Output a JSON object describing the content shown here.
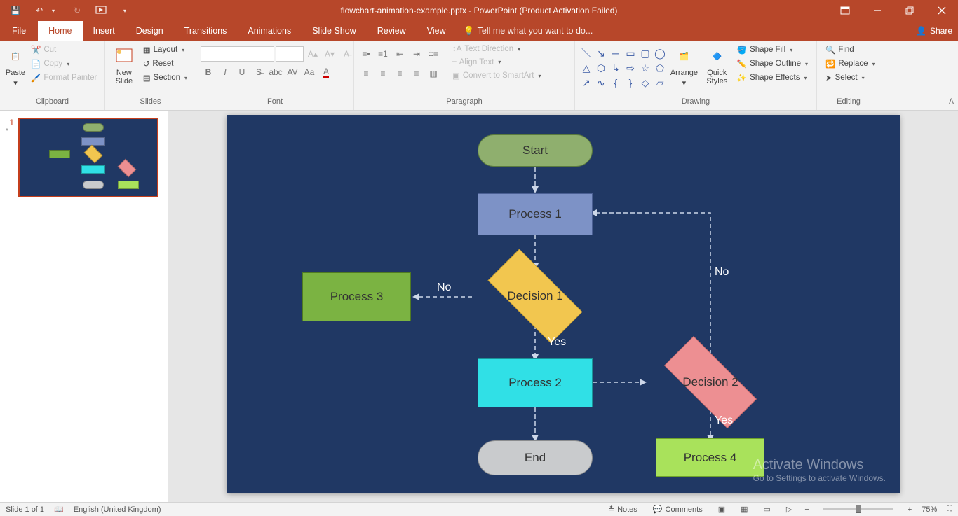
{
  "app": {
    "title": "flowchart-animation-example.pptx - PowerPoint (Product Activation Failed)"
  },
  "qat": {
    "save": "save",
    "undo": "undo",
    "redo": "redo",
    "startfrombeg": "start-from-beginning"
  },
  "wincontrols": {
    "ribbonopts": "ribbon-display-options",
    "min": "minimize",
    "max": "restore",
    "close": "close"
  },
  "tabs": {
    "file": "File",
    "home": "Home",
    "insert": "Insert",
    "design": "Design",
    "transitions": "Transitions",
    "animations": "Animations",
    "slideshow": "Slide Show",
    "review": "Review",
    "view": "View",
    "tellme": "Tell me what you want to do...",
    "share": "Share"
  },
  "ribbon": {
    "clipboard": {
      "paste": "Paste",
      "cut": "Cut",
      "copy": "Copy",
      "formatpainter": "Format Painter",
      "label": "Clipboard"
    },
    "slides": {
      "newslide": "New\nSlide",
      "layout": "Layout",
      "reset": "Reset",
      "section": "Section",
      "label": "Slides"
    },
    "font": {
      "label": "Font"
    },
    "paragraph": {
      "textdir": "Text Direction",
      "align": "Align Text",
      "smartart": "Convert to SmartArt",
      "label": "Paragraph"
    },
    "drawing": {
      "arrange": "Arrange",
      "quickstyles": "Quick\nStyles",
      "shapefill": "Shape Fill",
      "shapeoutline": "Shape Outline",
      "shapeeffects": "Shape Effects",
      "label": "Drawing"
    },
    "editing": {
      "find": "Find",
      "replace": "Replace",
      "select": "Select",
      "label": "Editing"
    }
  },
  "thumbs": {
    "slidenum": "1",
    "star": "*"
  },
  "flowchart": {
    "start": "Start",
    "p1": "Process 1",
    "d1": "Decision 1",
    "p3": "Process 3",
    "p2": "Process 2",
    "d2": "Decision 2",
    "p4": "Process 4",
    "end": "End",
    "no": "No",
    "yes": "Yes"
  },
  "watermark": {
    "l1": "Activate Windows",
    "l2": "Go to Settings to activate Windows."
  },
  "status": {
    "slide": "Slide 1 of 1",
    "lang": "English (United Kingdom)",
    "notes": "Notes",
    "comments": "Comments",
    "zoom": "75%"
  },
  "chart_data": {
    "type": "flowchart",
    "nodes": [
      {
        "id": "start",
        "kind": "terminator",
        "label": "Start"
      },
      {
        "id": "p1",
        "kind": "process",
        "label": "Process 1"
      },
      {
        "id": "d1",
        "kind": "decision",
        "label": "Decision 1"
      },
      {
        "id": "p3",
        "kind": "process",
        "label": "Process 3"
      },
      {
        "id": "p2",
        "kind": "process",
        "label": "Process 2"
      },
      {
        "id": "d2",
        "kind": "decision",
        "label": "Decision 2"
      },
      {
        "id": "p4",
        "kind": "process",
        "label": "Process 4"
      },
      {
        "id": "end",
        "kind": "terminator",
        "label": "End"
      }
    ],
    "edges": [
      {
        "from": "start",
        "to": "p1"
      },
      {
        "from": "p1",
        "to": "d1"
      },
      {
        "from": "d1",
        "to": "p2",
        "label": "Yes"
      },
      {
        "from": "d1",
        "to": "p3",
        "label": "No"
      },
      {
        "from": "p2",
        "to": "end"
      },
      {
        "from": "p2",
        "to": "d2"
      },
      {
        "from": "d2",
        "to": "p4",
        "label": "Yes"
      },
      {
        "from": "d2",
        "to": "p1",
        "label": "No",
        "routing": "up-then-left"
      }
    ]
  }
}
